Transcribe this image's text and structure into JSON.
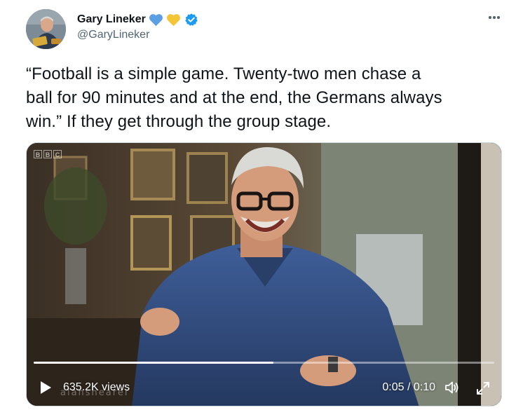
{
  "author": {
    "display_name": "Gary Lineker",
    "handle": "@GaryLineker",
    "heart_colors": [
      "#5c9fe5",
      "#f4c534"
    ],
    "verified_color": "#1d9bf0"
  },
  "tweet": {
    "text": "“Football is a simple game. Twenty-two men chase a\nball for 90 minutes and at the end, the Germans always\nwin.” If they get through the group stage."
  },
  "video": {
    "views": "635.2K views",
    "time": "0:05 / 0:10",
    "progress": 0.52,
    "watermark": "alanshearer",
    "channel_logo": [
      "B",
      "B",
      "C"
    ]
  },
  "icons": {
    "more": "more-horizontal-icon",
    "play": "play-icon",
    "volume": "volume-icon",
    "fullscreen": "fullscreen-icon"
  }
}
